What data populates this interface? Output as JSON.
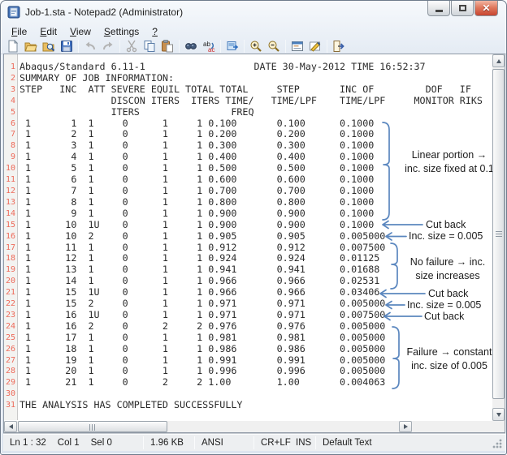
{
  "window": {
    "title": "Job-1.sta - Notepad2 (Administrator)"
  },
  "menubar": {
    "items": [
      "File",
      "Edit",
      "View",
      "Settings",
      "?"
    ]
  },
  "toolbar": {
    "icons": [
      "new-file",
      "open-file",
      "browse-files",
      "save-file",
      "undo",
      "redo",
      "cut",
      "copy",
      "paste",
      "find",
      "replace",
      "transparent-mode",
      "zoom-in",
      "zoom-out",
      "customize-schemes",
      "select-scheme",
      "exit"
    ]
  },
  "editor": {
    "lines": [
      "Abaqus/Standard 6.11-1                   DATE 30-May-2012 TIME 16:52:37",
      "SUMMARY OF JOB INFORMATION:",
      "STEP   INC  ATT SEVERE EQUIL TOTAL TOTAL     STEP       INC OF         DOF   IF",
      "                DISCON ITERS  ITERS TIME/   TIME/LPF    TIME/LPF     MONITOR RIKS",
      "                ITERS                FREQ",
      " 1       1  1     0      1     1 0.100       0.100      0.1000",
      " 1       2  1     0      1     1 0.200       0.200      0.1000",
      " 1       3  1     0      1     1 0.300       0.300      0.1000",
      " 1       4  1     0      1     1 0.400       0.400      0.1000",
      " 1       5  1     0      1     1 0.500       0.500      0.1000",
      " 1       6  1     0      1     1 0.600       0.600      0.1000",
      " 1       7  1     0      1     1 0.700       0.700      0.1000",
      " 1       8  1     0      1     1 0.800       0.800      0.1000",
      " 1       9  1     0      1     1 0.900       0.900      0.1000",
      " 1      10  1U    0      1     1 0.900       0.900      0.1000",
      " 1      10  2     0      1     1 0.905       0.905      0.005000",
      " 1      11  1     0      1     1 0.912       0.912      0.007500",
      " 1      12  1     0      1     1 0.924       0.924      0.01125",
      " 1      13  1     0      1     1 0.941       0.941      0.01688",
      " 1      14  1     0      1     1 0.966       0.966      0.02531",
      " 1      15  1U    0      1     1 0.966       0.966      0.03406",
      " 1      15  2     0      1     1 0.971       0.971      0.005000",
      " 1      16  1U    0      1     1 0.971       0.971      0.007500",
      " 1      16  2     0      2     2 0.976       0.976      0.005000",
      " 1      17  1     0      1     1 0.981       0.981      0.005000",
      " 1      18  1     0      1     1 0.986       0.986      0.005000",
      " 1      19  1     0      1     1 0.991       0.991      0.005000",
      " 1      20  1     0      1     1 0.996       0.996      0.005000",
      " 1      21  1     0      2     2 1.00        1.00       0.004063",
      "",
      "THE ANALYSIS HAS COMPLETED SUCCESSFULLY"
    ]
  },
  "annotations": {
    "color": "#5b87bf",
    "groups": [
      {
        "lines": [
          "Linear portion →",
          "inc. size fixed at 0.1"
        ]
      },
      {
        "lines": [
          "No failure → inc.",
          "size increases"
        ]
      },
      {
        "lines": [
          "Failure → constant",
          "inc. size of 0.005"
        ]
      }
    ],
    "arrows": [
      {
        "label": "Cut back"
      },
      {
        "label": "Inc. size = 0.005"
      },
      {
        "label": "Cut back"
      },
      {
        "label": "Inc. size = 0.005"
      },
      {
        "label": "Cut back"
      }
    ]
  },
  "statusbar": {
    "line_col": "Ln 1 : 32",
    "col": "Col 1",
    "sel": "Sel 0",
    "file_size": "1.96 KB",
    "encoding": "ANSI",
    "line_ending": "CR+LF",
    "insert_mode": "INS",
    "scheme": "Default Text"
  }
}
